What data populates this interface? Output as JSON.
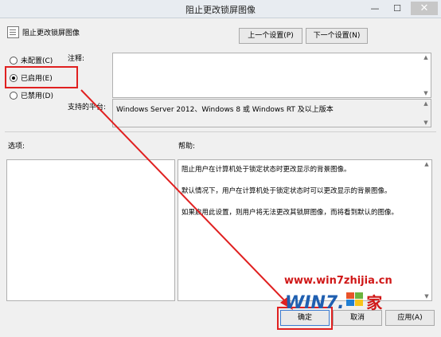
{
  "window": {
    "title": "阻止更改锁屏图像",
    "minimize_glyph": "—",
    "maximize_glyph": "☐",
    "close_glyph": "✕"
  },
  "header": {
    "setting_name": "阻止更改锁屏图像",
    "prev_button": "上一个设置(P)",
    "next_button": "下一个设置(N)"
  },
  "state": {
    "options": [
      {
        "label": "未配置(C)",
        "selected": false
      },
      {
        "label": "已启用(E)",
        "selected": true
      },
      {
        "label": "已禁用(D)",
        "selected": false
      }
    ]
  },
  "comment": {
    "label": "注释:",
    "value": ""
  },
  "supported": {
    "label": "支持的平台:",
    "value": "Windows Server 2012、Windows 8 或 Windows RT 及以上版本"
  },
  "options_panel": {
    "label": "选项:"
  },
  "help_panel": {
    "label": "帮助:",
    "lines": [
      "阻止用户在计算机处于锁定状态时更改显示的背景图像。",
      "默认情况下，用户在计算机处于锁定状态时可以更改显示的背景图像。",
      "如果启用此设置，则用户将无法更改其锁屏图像，而将看到默认的图像。"
    ]
  },
  "footer": {
    "ok_button": "确定",
    "cancel_button": "取消",
    "apply_button": "应用(A)"
  },
  "watermark": {
    "url": "www.win7zhijia.cn",
    "logo_text": "WIN7.",
    "logo_suffix": "家"
  },
  "colors": {
    "annotation_red": "#e02020",
    "watermark_red": "#d01818",
    "logo_blue": "#1f5fb0"
  }
}
